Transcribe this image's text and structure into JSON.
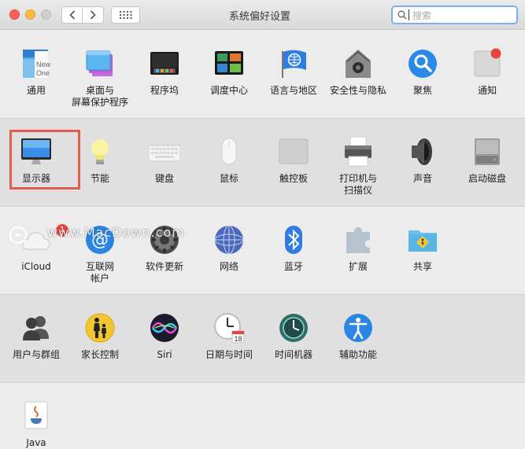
{
  "window": {
    "title": "系统偏好设置"
  },
  "search": {
    "placeholder": "搜索"
  },
  "rows": [
    [
      {
        "label": "通用",
        "icon": "general-icon"
      },
      {
        "label": "桌面与\n屏幕保护程序",
        "icon": "desktop-screensaver-icon"
      },
      {
        "label": "程序坞",
        "icon": "dock-icon"
      },
      {
        "label": "调度中心",
        "icon": "mission-control-icon"
      },
      {
        "label": "语言与地区",
        "icon": "language-region-icon"
      },
      {
        "label": "安全性与隐私",
        "icon": "security-privacy-icon"
      },
      {
        "label": "聚焦",
        "icon": "spotlight-icon"
      },
      {
        "label": "通知",
        "icon": "notifications-icon"
      }
    ],
    [
      {
        "label": "显示器",
        "icon": "displays-icon"
      },
      {
        "label": "节能",
        "icon": "energy-saver-icon"
      },
      {
        "label": "键盘",
        "icon": "keyboard-icon"
      },
      {
        "label": "鼠标",
        "icon": "mouse-icon"
      },
      {
        "label": "触控板",
        "icon": "trackpad-icon"
      },
      {
        "label": "打印机与\n扫描仪",
        "icon": "printers-scanners-icon"
      },
      {
        "label": "声音",
        "icon": "sound-icon"
      },
      {
        "label": "启动磁盘",
        "icon": "startup-disk-icon"
      }
    ],
    [
      {
        "label": "iCloud",
        "icon": "icloud-icon",
        "badge": "1"
      },
      {
        "label": "互联网\n帐户",
        "icon": "internet-accounts-icon"
      },
      {
        "label": "软件更新",
        "icon": "software-update-icon"
      },
      {
        "label": "网络",
        "icon": "network-icon"
      },
      {
        "label": "蓝牙",
        "icon": "bluetooth-icon"
      },
      {
        "label": "扩展",
        "icon": "extensions-icon"
      },
      {
        "label": "共享",
        "icon": "sharing-icon"
      }
    ],
    [
      {
        "label": "用户与群组",
        "icon": "users-groups-icon"
      },
      {
        "label": "家长控制",
        "icon": "parental-controls-icon"
      },
      {
        "label": "Siri",
        "icon": "siri-icon"
      },
      {
        "label": "日期与时间",
        "icon": "date-time-icon"
      },
      {
        "label": "时间机器",
        "icon": "time-machine-icon"
      },
      {
        "label": "辅助功能",
        "icon": "accessibility-icon"
      }
    ],
    [
      {
        "label": "Java",
        "icon": "java-icon"
      }
    ]
  ],
  "watermark": "www.MacDown.com",
  "icon_art": {
    "general_file_lines": [
      "File",
      "New",
      "One"
    ],
    "calendar_day": "18"
  },
  "colors": {
    "highlight": "#e45b4e",
    "search_focus": "#7eaef0",
    "badge": "#e5453b"
  }
}
